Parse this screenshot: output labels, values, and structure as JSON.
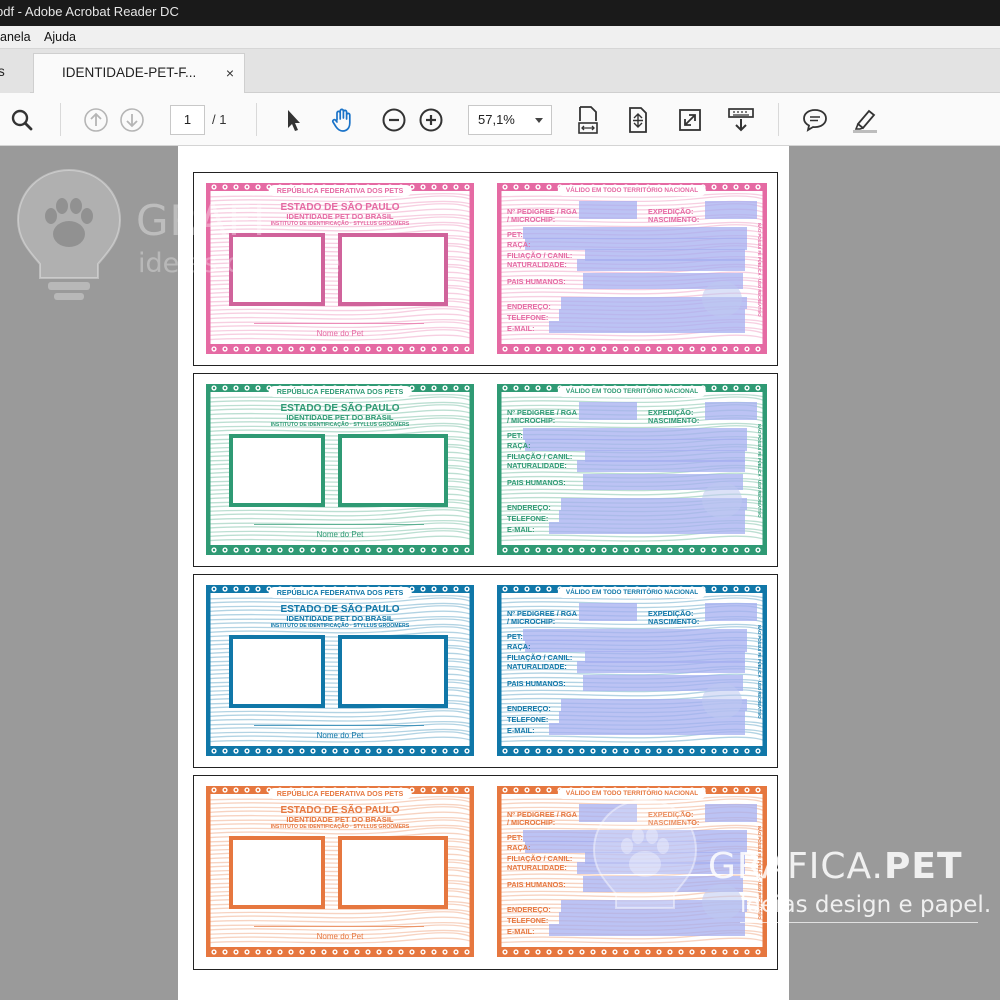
{
  "window": {
    "title": "pdf - Adobe Acrobat Reader DC"
  },
  "menu": {
    "items": [
      "anela",
      "Ajuda"
    ]
  },
  "tabs": {
    "prev_label": "s",
    "active_label": "IDENTIDADE-PET-F...",
    "close_glyph": "×"
  },
  "toolbar": {
    "page_current": "1",
    "page_total": "/ 1",
    "zoom": "57,1%",
    "icons": [
      "search-icon",
      "arrow-up-icon",
      "arrow-down-icon",
      "select-pointer-icon",
      "hand-tool-icon",
      "zoom-out-icon",
      "zoom-in-icon",
      "fit-width-icon",
      "full-page-icon",
      "full-screen-icon",
      "read-mode-icon",
      "comment-icon",
      "highlighter-icon"
    ]
  },
  "cards": [
    {
      "color": "#e56aa3",
      "photo_border": "#d0639b"
    },
    {
      "color": "#2f9a74",
      "photo_border": "#2f9a74"
    },
    {
      "color": "#1077a8",
      "photo_border": "#1077a8"
    },
    {
      "color": "#e6773f",
      "photo_border": "#e6773f"
    }
  ],
  "card_text": {
    "front_banner": "REPÚBLICA FEDERATIVA DOS PETS",
    "state": "ESTADO DE SÃO PAULO",
    "identity": "IDENTIDADE PET DO BRASIL",
    "institute": "INSTITUTO DE IDENTIFICAÇÃO · STYLLUS GROOMERS",
    "name_line": "Nome do Pet",
    "back_banner": "VÁLIDO EM TODO TERRITÓRIO NACIONAL",
    "pedigree": "Nº PEDIGREE / RGA",
    "microchip": "/ MICROCHIP:",
    "expedicao": "EXPEDIÇÃO:",
    "nascimento": "NASCIMENTO:",
    "pet": "PET:",
    "raca": "RAÇA:",
    "filiacao": "FILIAÇÃO / CANIL:",
    "naturalidade": "NATURALIDADE:",
    "pais": "PAIS HUMANOS:",
    "endereco": "ENDEREÇO:",
    "telefone": "TELEFONE:",
    "email": "E-MAIL:",
    "vertical": "NÃO POSSUI FÉ PÚBLICA · USO RECREATIVO"
  },
  "watermarks": {
    "top_brand": "GRAFI",
    "top_tagline": "ideias design e papel",
    "bottom_brand_a": "GRAFICA.",
    "bottom_brand_b": "PET",
    "bottom_tagline": "ideias design e papel."
  }
}
